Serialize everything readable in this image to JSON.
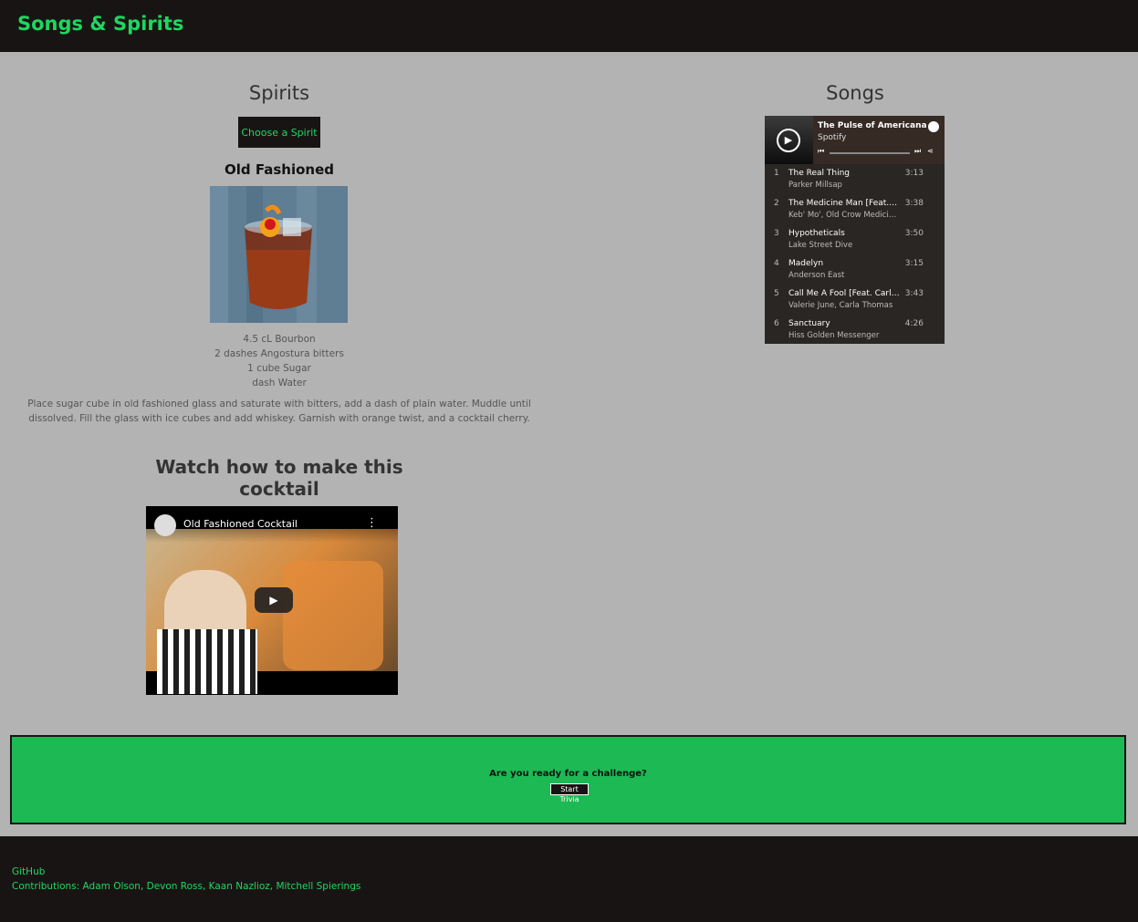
{
  "header": {
    "brand": "Songs & Spirits"
  },
  "spirits": {
    "heading": "Spirits",
    "choose_button": "Choose a Spirit",
    "drink_name": "Old Fashioned",
    "ingredients": [
      "4.5 cL Bourbon",
      "2 dashes Angostura bitters",
      "1 cube Sugar",
      "dash Water"
    ],
    "instructions": "Place sugar cube in old fashioned glass and saturate with bitters, add a dash of plain water. Muddle until dissolved. Fill the glass with ice cubes and add whiskey. Garnish with orange twist, and a cocktail cherry.",
    "watch_title": "Watch how to make this cocktail",
    "video": {
      "title": "Old Fashioned Cocktail",
      "menu_icon": "more-vertical-icon",
      "play_icon": "play-icon"
    }
  },
  "songs": {
    "heading": "Songs",
    "player": {
      "playlist_title": "The Pulse of Americana",
      "source": "Spotify",
      "tracks": [
        {
          "num": "1",
          "title": "The Real Thing",
          "artist": "Parker Millsap",
          "duration": "3:13"
        },
        {
          "num": "2",
          "title": "The Medicine Man [Feat. Ol...",
          "artist": "Keb' Mo', Old Crow Medicin...",
          "duration": "3:38"
        },
        {
          "num": "3",
          "title": "Hypotheticals",
          "artist": "Lake Street Dive",
          "duration": "3:50"
        },
        {
          "num": "4",
          "title": "Madelyn",
          "artist": "Anderson East",
          "duration": "3:15"
        },
        {
          "num": "5",
          "title": "Call Me A Fool [Feat. Carla ...",
          "artist": "Valerie June, Carla Thomas",
          "duration": "3:43"
        },
        {
          "num": "6",
          "title": "Sanctuary",
          "artist": "Hiss Golden Messenger",
          "duration": "4:26"
        }
      ]
    }
  },
  "challenge": {
    "question": "Are you ready for a challenge?",
    "button": "Start Trivia"
  },
  "footer": {
    "github": "GitHub",
    "contributions": "Contributions: Adam Olson, Devon Ross, Kaan Nazlioz, Mitchell Spierings"
  },
  "colors": {
    "accent": "#1ed760",
    "dark": "#191414",
    "page_bg": "#b3b3b3",
    "challenge_bg": "#1db954"
  }
}
